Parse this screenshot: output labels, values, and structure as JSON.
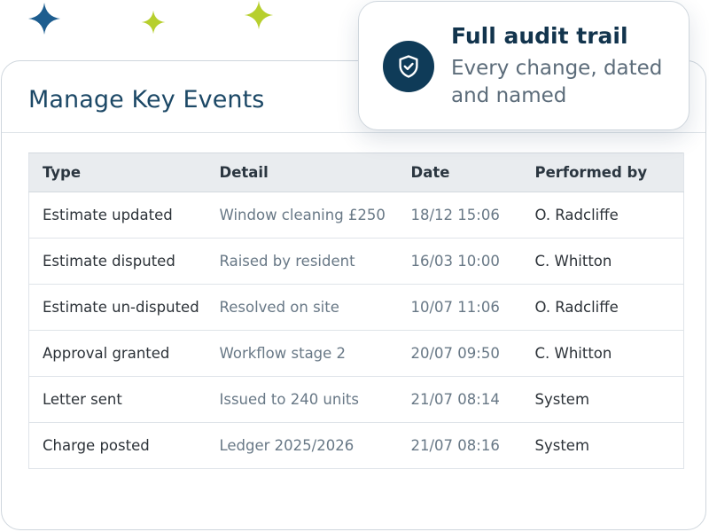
{
  "decor": {
    "sparkles": [
      {
        "icon": "four-point-star-icon",
        "color": "#1d5d8f"
      },
      {
        "icon": "four-point-star-icon",
        "color": "#b7cf2e"
      },
      {
        "icon": "four-point-star-icon",
        "color": "#b7cf2e"
      }
    ]
  },
  "card": {
    "title": "Manage Key Events",
    "table": {
      "columns": [
        "Type",
        "Detail",
        "Date",
        "Performed by"
      ],
      "rows": [
        {
          "type": "Estimate updated",
          "detail": "Window cleaning £250",
          "date": "18/12 15:06",
          "performed_by": "O. Radcliffe"
        },
        {
          "type": "Estimate disputed",
          "detail": "Raised by resident",
          "date": "16/03 10:00",
          "performed_by": "C. Whitton"
        },
        {
          "type": "Estimate un-disputed",
          "detail": "Resolved on site",
          "date": "10/07 11:06",
          "performed_by": "O. Radcliffe"
        },
        {
          "type": "Approval granted",
          "detail": "Workflow stage 2",
          "date": "20/07 09:50",
          "performed_by": "C. Whitton"
        },
        {
          "type": "Letter sent",
          "detail": "Issued to 240 units",
          "date": "21/07 08:14",
          "performed_by": "System"
        },
        {
          "type": "Charge posted",
          "detail": "Ledger 2025/2026",
          "date": "21/07 08:16",
          "performed_by": "System"
        }
      ]
    }
  },
  "callout": {
    "icon": "shield-check-icon",
    "title": "Full audit trail",
    "description": "Every change, dated and named"
  },
  "colors": {
    "brand_navy": "#0f3b58",
    "title_blue": "#1c4866",
    "accent_lime": "#b7cf2e",
    "accent_blue": "#1d5d8f",
    "header_bg": "#e9ecef"
  }
}
